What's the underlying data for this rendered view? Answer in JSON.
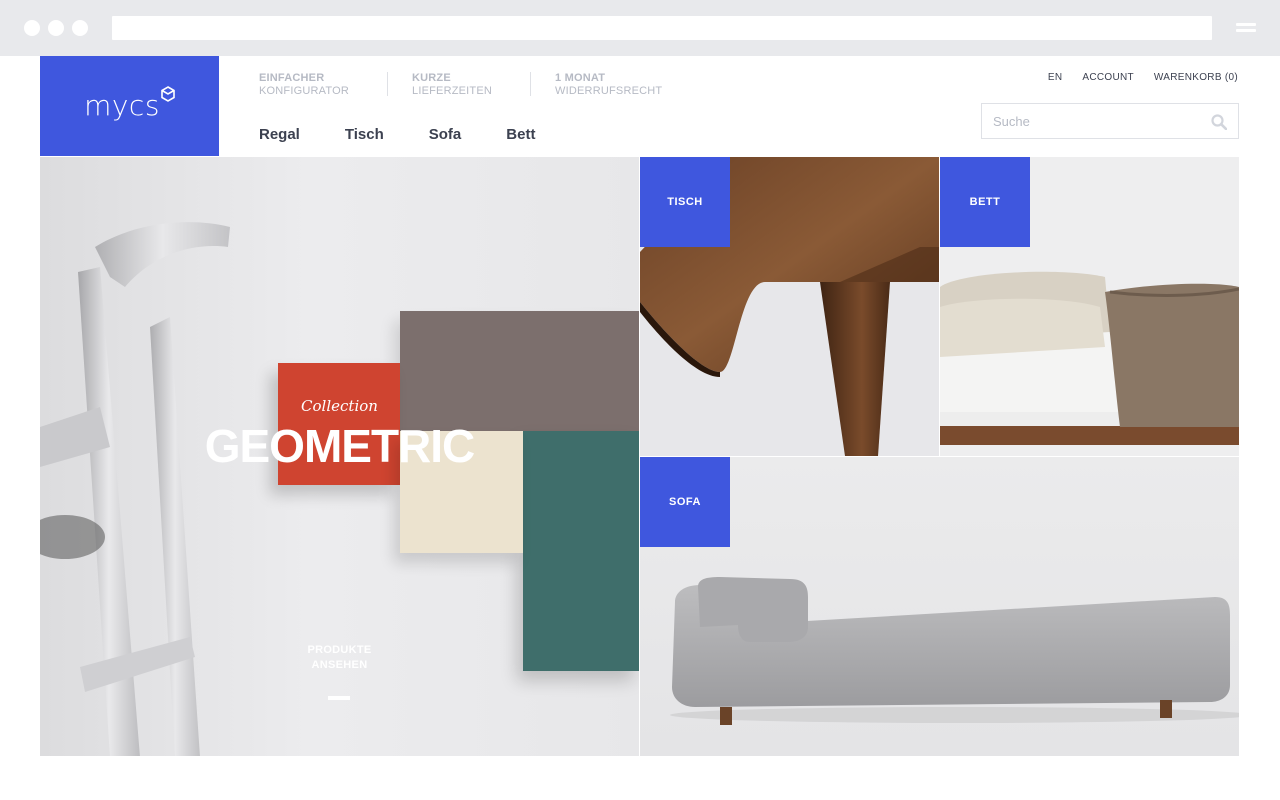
{
  "brand": {
    "name": "mycs",
    "color": "#3f57de"
  },
  "usps": [
    {
      "strong": "EINFACHER",
      "light": "KONFIGURATOR"
    },
    {
      "strong": "KURZE",
      "light": "LIEFERZEITEN"
    },
    {
      "strong": "1 MONAT",
      "light": "WIDERRUFSRECHT"
    }
  ],
  "nav": [
    "Regal",
    "Tisch",
    "Sofa",
    "Bett"
  ],
  "topright": {
    "lang": "EN",
    "account": "ACCOUNT",
    "cart": "WARENKORB (0)"
  },
  "search": {
    "placeholder": "Suche",
    "value": ""
  },
  "hero": {
    "collection": "Collection",
    "title": "GEOMETRIC",
    "cta_line1": "PRODUKTE",
    "cta_line2": "ANSEHEN"
  },
  "tiles": {
    "tisch": "TISCH",
    "bett": "BETT",
    "sofa": "SOFA"
  }
}
